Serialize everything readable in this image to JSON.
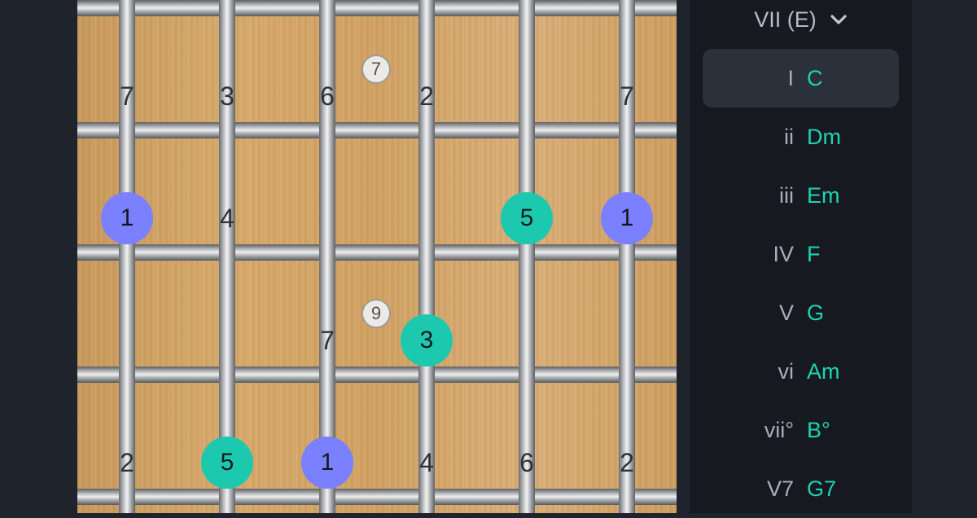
{
  "fretboard": {
    "inlays": [
      "7",
      "9"
    ],
    "degree_labels": [
      "7",
      "3",
      "6",
      "2",
      "7",
      "4",
      "7",
      "2",
      "4",
      "6",
      "2"
    ],
    "note_dots": [
      {
        "label": "1",
        "kind": "root"
      },
      {
        "label": "5",
        "kind": "tone"
      },
      {
        "label": "1",
        "kind": "root"
      },
      {
        "label": "3",
        "kind": "tone"
      },
      {
        "label": "5",
        "kind": "tone"
      },
      {
        "label": "1",
        "kind": "root"
      }
    ],
    "colors": {
      "root": "#7a80ff",
      "tone": "#1cc9ae"
    }
  },
  "panel": {
    "mode_select": {
      "value": "VII (E)",
      "icon": "chevron-down-icon"
    },
    "chords": [
      {
        "roman": "I",
        "name": "C",
        "active": true
      },
      {
        "roman": "ii",
        "name": "Dm"
      },
      {
        "roman": "iii",
        "name": "Em"
      },
      {
        "roman": "IV",
        "name": "F"
      },
      {
        "roman": "V",
        "name": "G"
      },
      {
        "roman": "vi",
        "name": "Am"
      },
      {
        "roman": "vii°",
        "name": "B°"
      },
      {
        "roman": "V7",
        "name": "G7"
      }
    ],
    "colors": {
      "chord_name": "#1ed3b5",
      "active_row": "#2b313b"
    }
  }
}
